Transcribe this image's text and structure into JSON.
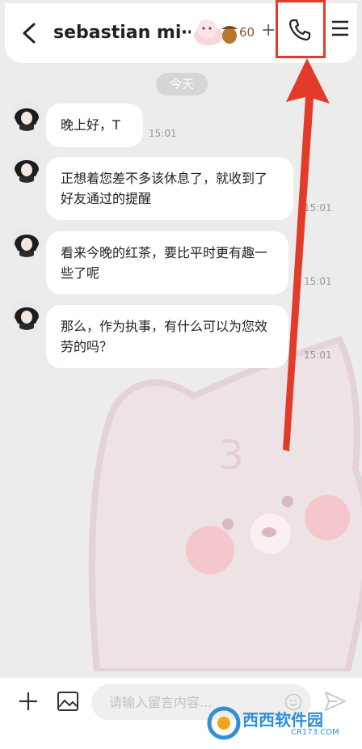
{
  "header": {
    "title": "sebastian mi⋯",
    "acorn_count": "60",
    "add_symbol": "+"
  },
  "date_chip": "今天",
  "messages": [
    {
      "text": "晚上好，T",
      "time": "15:01"
    },
    {
      "text": "正想着您差不多该休息了，就收到了好友通过的提醒",
      "time": "15:01"
    },
    {
      "text": "看来今晚的红茶，要比平时更有趣一些了呢",
      "time": "15:01"
    },
    {
      "text": "那么，作为执事，有什么可以为您效劳的吗？",
      "time": "15:01"
    }
  ],
  "composer": {
    "placeholder": "请输入留言内容..."
  },
  "watermark": {
    "brand": "西西软件园",
    "site": "CR173.COM"
  },
  "colors": {
    "highlight": "#e33b2a",
    "background": "#ececec"
  }
}
